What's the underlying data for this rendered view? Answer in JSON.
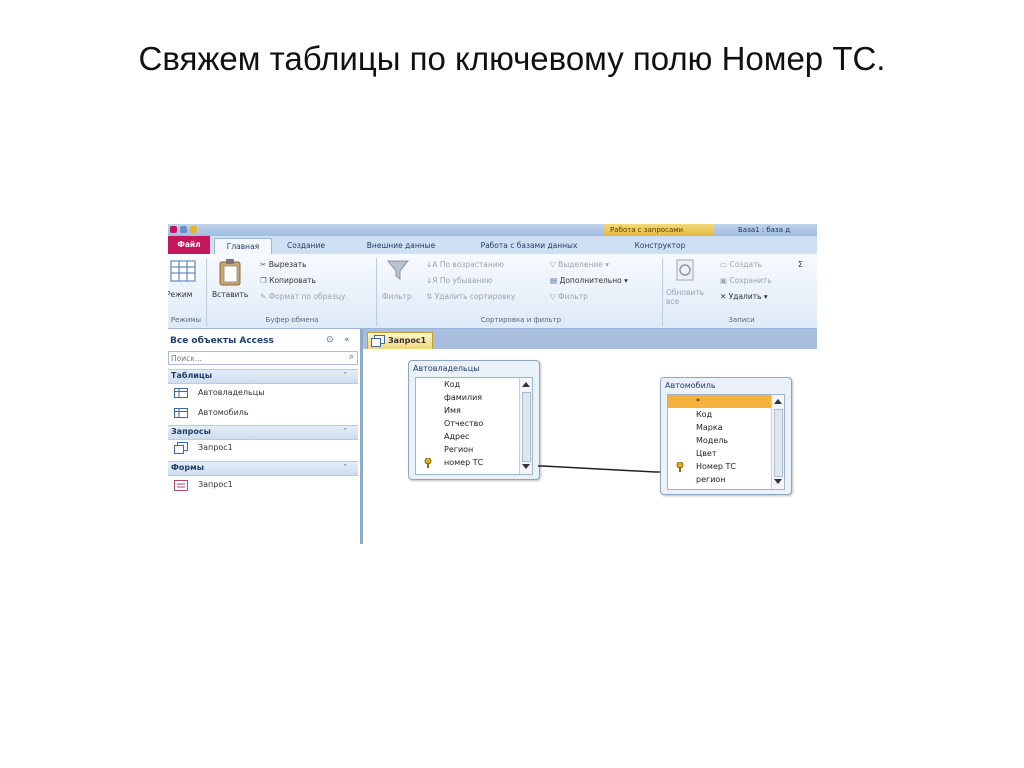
{
  "slide": {
    "title": "Свяжем таблицы по ключевому полю Номер ТС."
  },
  "window": {
    "context_tab": "Работа с запросами",
    "title": "База1 : база д"
  },
  "ribbon_tabs": [
    {
      "label": "Файл"
    },
    {
      "label": "Главная"
    },
    {
      "label": "Создание"
    },
    {
      "label": "Внешние данные"
    },
    {
      "label": "Работа с базами данных"
    },
    {
      "label": "Конструктор"
    }
  ],
  "ribbon": {
    "views": {
      "label": "Режимы",
      "button": "Режим"
    },
    "clipboard": {
      "label": "Буфер обмена",
      "paste": "Вставить",
      "cut": "Вырезать",
      "copy": "Копировать",
      "format_painter": "Формат по образцу"
    },
    "sort_filter": {
      "label": "Сортировка и фильтр",
      "filter": "Фильтр",
      "asc": "По возрастанию",
      "desc": "По убыванию",
      "remove_sort": "Удалить сортировку",
      "selection": "Выделение",
      "advanced": "Дополнительно",
      "toggle_filter": "Фильтр"
    },
    "records": {
      "label": "Записи",
      "refresh": "Обновить все",
      "new": "Создать",
      "save": "Сохранить",
      "delete": "Удалить",
      "sigma": "Σ"
    }
  },
  "nav_pane": {
    "header": "Все объекты Access",
    "search_placeholder": "Поиск...",
    "sections": [
      {
        "title": "Таблицы",
        "items": [
          "Автовладельцы",
          "Автомобиль"
        ]
      },
      {
        "title": "Запросы",
        "items": [
          "Запрос1"
        ]
      },
      {
        "title": "Формы",
        "items": [
          "Запрос1"
        ]
      }
    ]
  },
  "query": {
    "tab": "Запрос1",
    "tables": [
      {
        "name": "Автовладельцы",
        "fields": [
          "Код",
          "фамилия",
          "Имя",
          "Отчество",
          "Адрес",
          "Регион",
          "номер ТС"
        ],
        "key_field": "номер ТС"
      },
      {
        "name": "Автомобиль",
        "fields": [
          "*",
          "Код",
          "Марка",
          "Модель",
          "Цвет",
          "Номер ТС",
          "регион"
        ],
        "key_field": "Номер ТС",
        "selected": "*"
      }
    ],
    "relationship": {
      "from": "номер ТС",
      "to": "Номер ТС"
    }
  }
}
